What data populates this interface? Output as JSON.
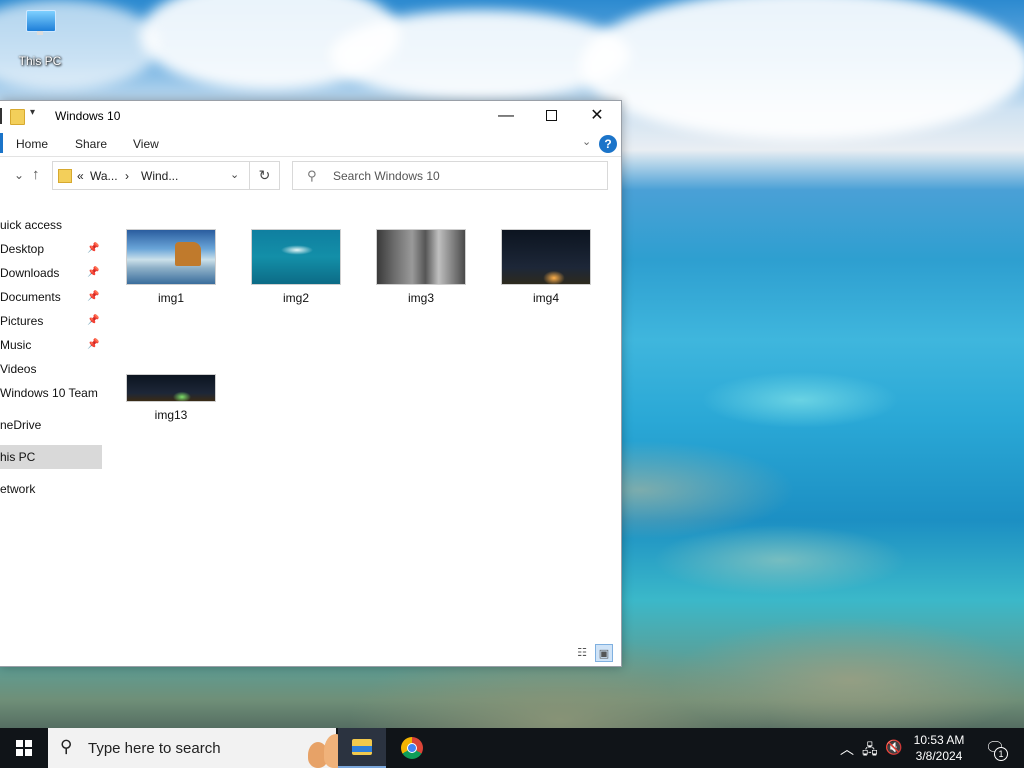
{
  "desktop": {
    "icon_label": "This PC"
  },
  "window": {
    "title": "Windows 10",
    "ribbon_tabs": [
      "Home",
      "Share",
      "View"
    ],
    "help_label": "?",
    "address": {
      "prefix": "«",
      "crumbs": [
        "Wa...",
        "Wind..."
      ],
      "separator": "›"
    },
    "search_placeholder": "Search Windows 10",
    "sidebar": [
      {
        "label": "uick access",
        "pinned": false,
        "selected": false
      },
      {
        "label": "Desktop",
        "pinned": true,
        "selected": false
      },
      {
        "label": "Downloads",
        "pinned": true,
        "selected": false
      },
      {
        "label": "Documents",
        "pinned": true,
        "selected": false
      },
      {
        "label": "Pictures",
        "pinned": true,
        "selected": false
      },
      {
        "label": "Music",
        "pinned": true,
        "selected": false
      },
      {
        "label": "Videos",
        "pinned": false,
        "selected": false
      },
      {
        "label": "Windows 10 Team",
        "pinned": false,
        "selected": false
      },
      {
        "label": "neDrive",
        "pinned": false,
        "selected": false
      },
      {
        "label": "his PC",
        "pinned": false,
        "selected": true
      },
      {
        "label": "etwork",
        "pinned": false,
        "selected": false
      }
    ],
    "files": [
      {
        "name": "img1"
      },
      {
        "name": "img2"
      },
      {
        "name": "img3"
      },
      {
        "name": "img4"
      },
      {
        "name": "img13"
      }
    ]
  },
  "taskbar": {
    "search_placeholder": "Type here to search",
    "clock_time": "10:53 AM",
    "clock_date": "3/8/2024",
    "notification_count": "1"
  },
  "colors": {
    "accent": "#1b74c9",
    "taskbar": "#101418",
    "selected_sidebar": "#d9d9d9"
  }
}
